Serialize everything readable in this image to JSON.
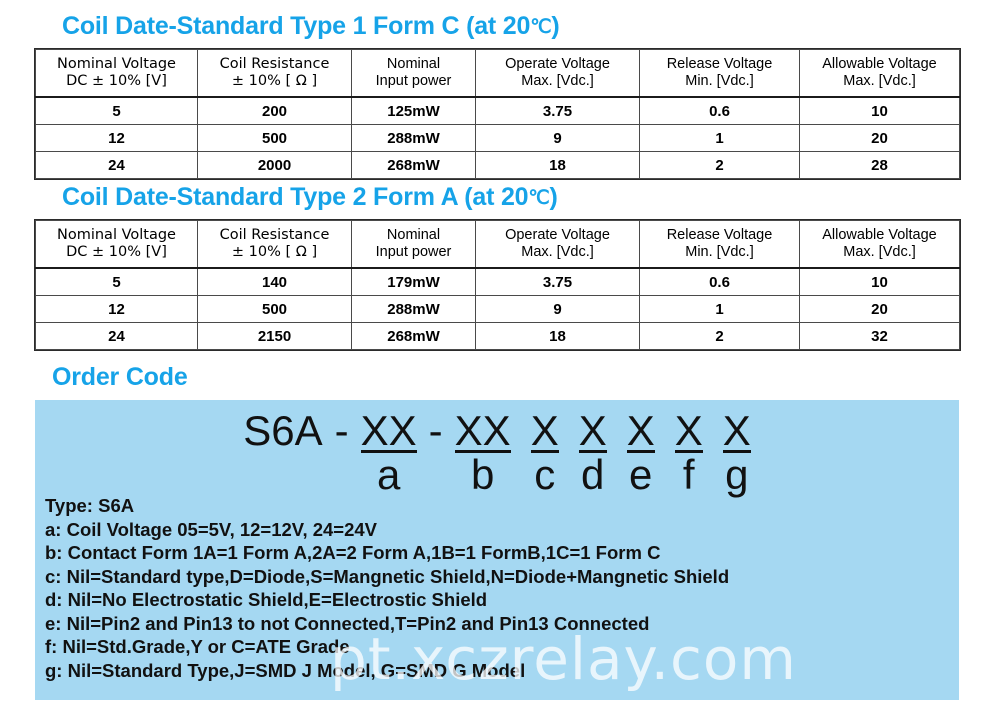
{
  "tables": [
    {
      "title_prefix": "Coil Date-Standard Type 1 Form C (at 20",
      "title_unit": "℃",
      "title_suffix": ")",
      "headers": [
        {
          "l1": "Nominal Voltage",
          "l2": "DC ± 10% [V]"
        },
        {
          "l1": "Coil Resistance",
          "l2": "± 10% [ Ω ]"
        },
        {
          "l1": "Nominal",
          "l2": "Input power"
        },
        {
          "l1": "Operate Voltage",
          "l2": "Max. [Vdc.]"
        },
        {
          "l1": "Release Voltage",
          "l2": "Min.  [Vdc.]"
        },
        {
          "l1": "Allowable Voltage",
          "l2": "Max. [Vdc.]"
        }
      ],
      "rows": [
        [
          "5",
          "200",
          "125mW",
          "3.75",
          "0.6",
          "10"
        ],
        [
          "12",
          "500",
          "288mW",
          "9",
          "1",
          "20"
        ],
        [
          "24",
          "2000",
          "268mW",
          "18",
          "2",
          "28"
        ]
      ]
    },
    {
      "title_prefix": "Coil Date-Standard Type 2 Form A (at 20",
      "title_unit": "℃",
      "title_suffix": ")",
      "headers": [
        {
          "l1": "Nominal Voltage",
          "l2": "DC ± 10% [V]"
        },
        {
          "l1": "Coil Resistance",
          "l2": "± 10% [ Ω ]"
        },
        {
          "l1": "Nominal",
          "l2": "Input power"
        },
        {
          "l1": "Operate Voltage",
          "l2": "Max. [Vdc.]"
        },
        {
          "l1": "Release Voltage",
          "l2": "Min.  [Vdc.]"
        },
        {
          "l1": "Allowable Voltage",
          "l2": "Max. [Vdc.]"
        }
      ],
      "rows": [
        [
          "5",
          "140",
          "179mW",
          "3.75",
          "0.6",
          "10"
        ],
        [
          "12",
          "500",
          "288mW",
          "9",
          "1",
          "20"
        ],
        [
          "24",
          "2150",
          "268mW",
          "18",
          "2",
          "32"
        ]
      ]
    }
  ],
  "order_code": {
    "heading": "Order Code",
    "prefix": "S6A",
    "dash1": "-",
    "dash2": "-",
    "segments": [
      {
        "top": "XX",
        "bot": "a"
      },
      {
        "top": "XX",
        "bot": "b"
      },
      {
        "top": "X",
        "bot": "c"
      },
      {
        "top": "X",
        "bot": "d"
      },
      {
        "top": "X",
        "bot": "e"
      },
      {
        "top": "X",
        "bot": "f"
      },
      {
        "top": "X",
        "bot": "g"
      }
    ],
    "legend": [
      "Type: S6A",
      "a: Coil Voltage 05=5V, 12=12V, 24=24V",
      "b: Contact Form 1A=1 Form A,2A=2 Form A,1B=1 FormB,1C=1 Form C",
      "c: Nil=Standard type,D=Diode,S=Mangnetic Shield,N=Diode+Mangnetic Shield",
      "d: Nil=No Electrostatic Shield,E=Electrostic Shield",
      "e: Nil=Pin2 and Pin13 to not Connected,T=Pin2 and Pin13  Connected",
      "f:  Nil=Std.Grade,Y or C=ATE Grade",
      "g: Nil=Standard Type,J=SMD J Model, G=SMD G Model"
    ]
  },
  "watermark": "pt.xczrelay.com",
  "colors": {
    "heading_blue": "#16a3e8",
    "panel_blue": "#a5d8f2",
    "table_border": "#4a4a4a",
    "text": "#111111"
  }
}
